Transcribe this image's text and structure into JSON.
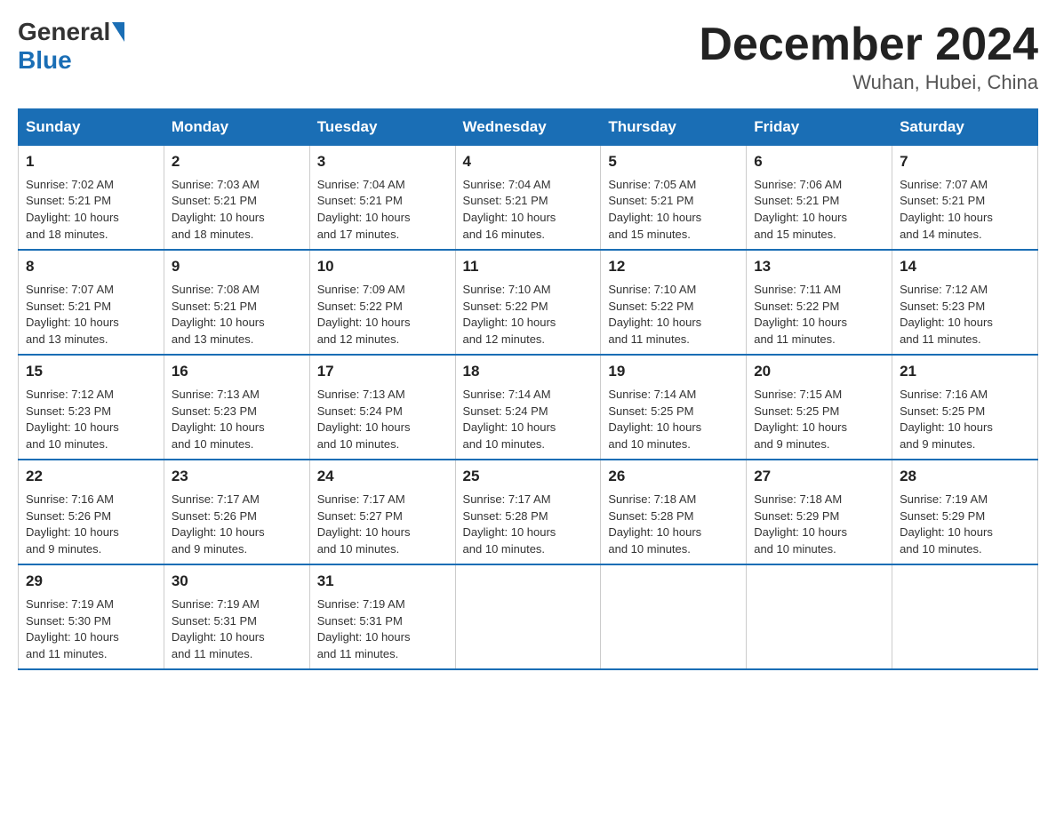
{
  "header": {
    "logo_general": "General",
    "logo_blue": "Blue",
    "month_title": "December 2024",
    "location": "Wuhan, Hubei, China"
  },
  "days_of_week": [
    "Sunday",
    "Monday",
    "Tuesday",
    "Wednesday",
    "Thursday",
    "Friday",
    "Saturday"
  ],
  "weeks": [
    [
      {
        "day": "1",
        "sunrise": "7:02 AM",
        "sunset": "5:21 PM",
        "daylight": "10 hours and 18 minutes."
      },
      {
        "day": "2",
        "sunrise": "7:03 AM",
        "sunset": "5:21 PM",
        "daylight": "10 hours and 18 minutes."
      },
      {
        "day": "3",
        "sunrise": "7:04 AM",
        "sunset": "5:21 PM",
        "daylight": "10 hours and 17 minutes."
      },
      {
        "day": "4",
        "sunrise": "7:04 AM",
        "sunset": "5:21 PM",
        "daylight": "10 hours and 16 minutes."
      },
      {
        "day": "5",
        "sunrise": "7:05 AM",
        "sunset": "5:21 PM",
        "daylight": "10 hours and 15 minutes."
      },
      {
        "day": "6",
        "sunrise": "7:06 AM",
        "sunset": "5:21 PM",
        "daylight": "10 hours and 15 minutes."
      },
      {
        "day": "7",
        "sunrise": "7:07 AM",
        "sunset": "5:21 PM",
        "daylight": "10 hours and 14 minutes."
      }
    ],
    [
      {
        "day": "8",
        "sunrise": "7:07 AM",
        "sunset": "5:21 PM",
        "daylight": "10 hours and 13 minutes."
      },
      {
        "day": "9",
        "sunrise": "7:08 AM",
        "sunset": "5:21 PM",
        "daylight": "10 hours and 13 minutes."
      },
      {
        "day": "10",
        "sunrise": "7:09 AM",
        "sunset": "5:22 PM",
        "daylight": "10 hours and 12 minutes."
      },
      {
        "day": "11",
        "sunrise": "7:10 AM",
        "sunset": "5:22 PM",
        "daylight": "10 hours and 12 minutes."
      },
      {
        "day": "12",
        "sunrise": "7:10 AM",
        "sunset": "5:22 PM",
        "daylight": "10 hours and 11 minutes."
      },
      {
        "day": "13",
        "sunrise": "7:11 AM",
        "sunset": "5:22 PM",
        "daylight": "10 hours and 11 minutes."
      },
      {
        "day": "14",
        "sunrise": "7:12 AM",
        "sunset": "5:23 PM",
        "daylight": "10 hours and 11 minutes."
      }
    ],
    [
      {
        "day": "15",
        "sunrise": "7:12 AM",
        "sunset": "5:23 PM",
        "daylight": "10 hours and 10 minutes."
      },
      {
        "day": "16",
        "sunrise": "7:13 AM",
        "sunset": "5:23 PM",
        "daylight": "10 hours and 10 minutes."
      },
      {
        "day": "17",
        "sunrise": "7:13 AM",
        "sunset": "5:24 PM",
        "daylight": "10 hours and 10 minutes."
      },
      {
        "day": "18",
        "sunrise": "7:14 AM",
        "sunset": "5:24 PM",
        "daylight": "10 hours and 10 minutes."
      },
      {
        "day": "19",
        "sunrise": "7:14 AM",
        "sunset": "5:25 PM",
        "daylight": "10 hours and 10 minutes."
      },
      {
        "day": "20",
        "sunrise": "7:15 AM",
        "sunset": "5:25 PM",
        "daylight": "10 hours and 9 minutes."
      },
      {
        "day": "21",
        "sunrise": "7:16 AM",
        "sunset": "5:25 PM",
        "daylight": "10 hours and 9 minutes."
      }
    ],
    [
      {
        "day": "22",
        "sunrise": "7:16 AM",
        "sunset": "5:26 PM",
        "daylight": "10 hours and 9 minutes."
      },
      {
        "day": "23",
        "sunrise": "7:17 AM",
        "sunset": "5:26 PM",
        "daylight": "10 hours and 9 minutes."
      },
      {
        "day": "24",
        "sunrise": "7:17 AM",
        "sunset": "5:27 PM",
        "daylight": "10 hours and 10 minutes."
      },
      {
        "day": "25",
        "sunrise": "7:17 AM",
        "sunset": "5:28 PM",
        "daylight": "10 hours and 10 minutes."
      },
      {
        "day": "26",
        "sunrise": "7:18 AM",
        "sunset": "5:28 PM",
        "daylight": "10 hours and 10 minutes."
      },
      {
        "day": "27",
        "sunrise": "7:18 AM",
        "sunset": "5:29 PM",
        "daylight": "10 hours and 10 minutes."
      },
      {
        "day": "28",
        "sunrise": "7:19 AM",
        "sunset": "5:29 PM",
        "daylight": "10 hours and 10 minutes."
      }
    ],
    [
      {
        "day": "29",
        "sunrise": "7:19 AM",
        "sunset": "5:30 PM",
        "daylight": "10 hours and 11 minutes."
      },
      {
        "day": "30",
        "sunrise": "7:19 AM",
        "sunset": "5:31 PM",
        "daylight": "10 hours and 11 minutes."
      },
      {
        "day": "31",
        "sunrise": "7:19 AM",
        "sunset": "5:31 PM",
        "daylight": "10 hours and 11 minutes."
      },
      null,
      null,
      null,
      null
    ]
  ],
  "labels": {
    "sunrise": "Sunrise:",
    "sunset": "Sunset:",
    "daylight": "Daylight:"
  }
}
